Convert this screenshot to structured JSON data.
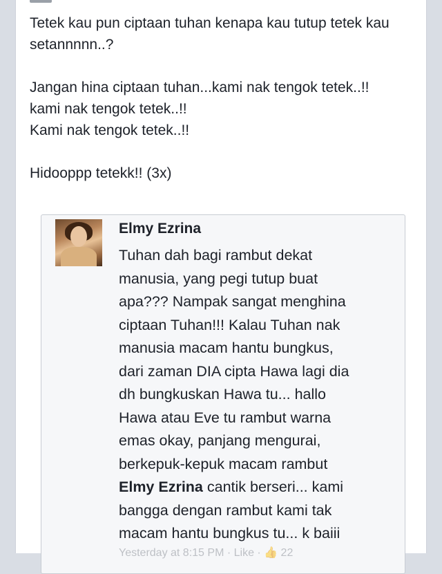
{
  "post": {
    "lines": [
      "Tetek kau pun ciptaan tuhan kenapa kau tutup tetek kau setannnnn..?",
      "",
      "Jangan hina ciptaan tuhan...kami nak tengok tetek..!!",
      "kami nak tengok tetek..!!",
      "Kami nak tengok tetek..!!",
      "",
      "Hidooppp tetekk!! (3x)"
    ]
  },
  "quoted_comment": {
    "avatar_icon": "user-avatar-photo",
    "name": "Elmy Ezrina",
    "text_before_mention": "Tuhan dah bagi rambut dekat\nmanusia, yang pegi tutup buat\napa??? Nampak sangat menghina\nciptaan Tuhan!!! Kalau Tuhan nak\nmanusia macam hantu bungkus,\ndari zaman DIA cipta Hawa lagi dia\ndh bungkuskan Hawa tu... hallo\nHawa atau Eve tu rambut warna\nemas okay, panjang mengurai,\nberkepuk-kepuk macam rambut\n",
    "mention": "Elmy Ezrina",
    "text_after_mention": " cantik berseri... kami\nbangga dengan rambut kami tak\nmacam hantu bungkus tu... k baiii",
    "meta": "Yesterday at 8:15 PM · Like · 👍 22"
  },
  "colors": {
    "background": "#d9dde4",
    "card": "#ffffff",
    "text": "#1d2129",
    "muted": "#90949c"
  }
}
